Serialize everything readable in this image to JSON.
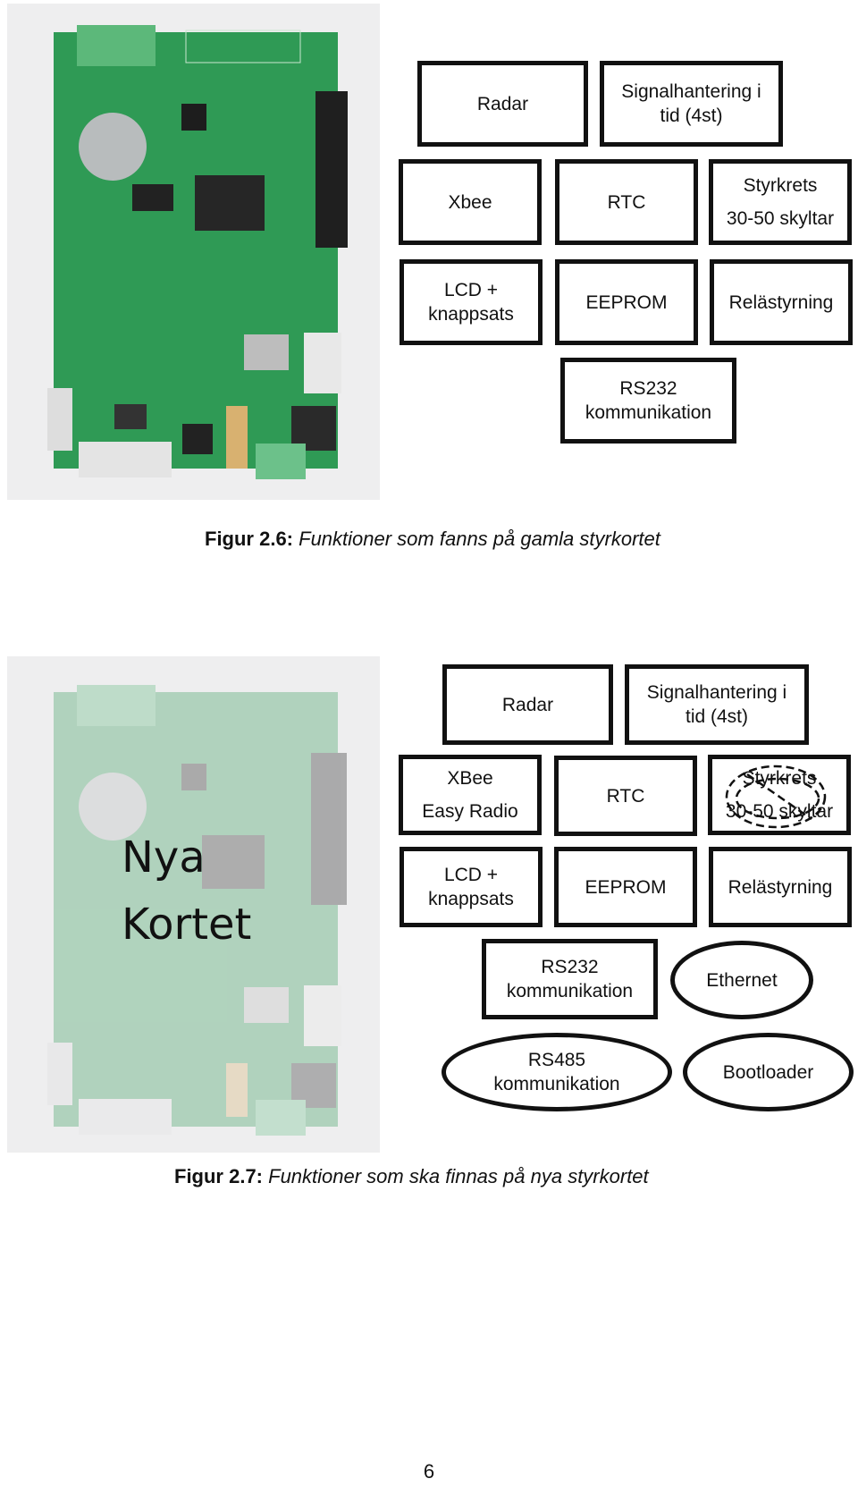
{
  "page": {
    "page_number": "6"
  },
  "figure_old": {
    "photo_alt": "PCB photo of old control board",
    "boxes": {
      "radar": [
        "Radar"
      ],
      "signal": [
        "Signalhantering i",
        "tid (4st)"
      ],
      "xbee": [
        "Xbee"
      ],
      "rtc": [
        "RTC"
      ],
      "styrkrets": [
        "Styrkrets",
        "30-50 skyltar"
      ],
      "lcd": [
        "LCD +",
        "knappsats"
      ],
      "eeprom": [
        "EEPROM"
      ],
      "rela": [
        "Relästyrning"
      ],
      "rs232": [
        "RS232",
        "kommunikation"
      ]
    },
    "caption": {
      "label": "Figur 2.6:",
      "text": " Funktioner som fanns på gamla styrkortet"
    }
  },
  "figure_new": {
    "photo_alt": "Faded PCB photo of new control board",
    "overlay_text": [
      "Nya",
      "Kortet"
    ],
    "boxes": {
      "radar": [
        "Radar"
      ],
      "signal": [
        "Signalhantering i",
        "tid (4st)"
      ],
      "xbee": [
        "XBee",
        "Easy Radio"
      ],
      "rtc": [
        "RTC"
      ],
      "styrkrets": [
        "Styrkrets",
        "30-50 skyltar"
      ],
      "lcd": [
        "LCD +",
        "knappsats"
      ],
      "eeprom": [
        "EEPROM"
      ],
      "rela": [
        "Relästyrning"
      ],
      "rs232": [
        "RS232",
        "kommunikation"
      ],
      "ethernet": [
        "Ethernet"
      ],
      "rs485": [
        "RS485",
        "kommunikation"
      ],
      "bootloader": [
        "Bootloader"
      ]
    },
    "styrkrets_crossed_out": true,
    "caption": {
      "label": "Figur 2.7:",
      "text": " Funktioner som ska finnas på nya styrkortet"
    }
  },
  "colors": {
    "pcb_green": "#2f9a55",
    "box_border": "#111111"
  }
}
